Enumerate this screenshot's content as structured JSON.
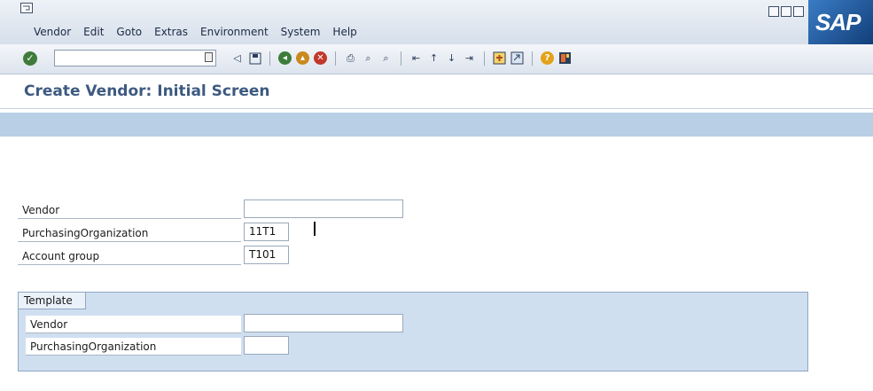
{
  "menubar": {
    "items": [
      "Vendor",
      "Edit",
      "Goto",
      "Extras",
      "Environment",
      "System",
      "Help"
    ],
    "brand": "SAP"
  },
  "toolbar": {
    "command_value": "",
    "icons": [
      "back-icon",
      "save-icon",
      "back-green-icon",
      "exit-icon",
      "cancel-icon",
      "print-icon",
      "find-icon",
      "find-next-icon",
      "first-page-icon",
      "prev-page-icon",
      "next-page-icon",
      "last-page-icon",
      "new-session-icon",
      "shortcut-icon",
      "help-icon",
      "layout-icon"
    ]
  },
  "page": {
    "title": "Create Vendor: Initial Screen"
  },
  "form": {
    "vendor_label": "Vendor",
    "vendor_value": "",
    "purch_org_label": "PurchasingOrganization",
    "purch_org_value": "11T1",
    "account_group_label": "Account group",
    "account_group_value": "T101"
  },
  "template": {
    "title": "Template",
    "vendor_label": "Vendor",
    "vendor_value": "",
    "purch_org_label": "PurchasingOrganization",
    "purch_org_value": ""
  },
  "colors": {
    "title": "#3d5a80",
    "appbar": "#b8cfe6",
    "template_bg": "#d0dff0"
  }
}
